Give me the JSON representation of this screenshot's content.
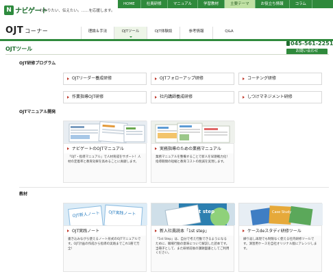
{
  "brand": {
    "logo_mark": "N",
    "logo_text": "ナビゲート",
    "tagline": "わかりたい、伝えたい。……を応援します。"
  },
  "topnav": [
    {
      "label": "HOME",
      "active": false
    },
    {
      "label": "社員研修",
      "active": false
    },
    {
      "label": "マニュアル",
      "active": false
    },
    {
      "label": "学習教材",
      "active": false
    },
    {
      "label": "主要テーマ",
      "active": true
    },
    {
      "label": "お役立ち情報",
      "active": false
    },
    {
      "label": "コラム",
      "active": false
    }
  ],
  "header": {
    "title": "OJT",
    "title_sub": "コーナー",
    "phone": "045-561-2251",
    "contact_label": "お問い合わせ"
  },
  "mainnav": [
    {
      "label": "理論＆手法",
      "active": false
    },
    {
      "label": "OJTツール",
      "active": true
    },
    {
      "label": "OJT体験談",
      "active": false
    },
    {
      "label": "参考情報",
      "active": false
    },
    {
      "label": "Q&A",
      "active": false
    }
  ],
  "section_title": "OJTツール",
  "programs": {
    "heading": "OJT研修プログラム",
    "items": [
      "OJTリーダー養成研修",
      "OJTフォローアップ研修",
      "コーチング研修",
      "作業指導OJT研修",
      "社内講師養成研修",
      "しつけマネジメント研修"
    ]
  },
  "manual": {
    "heading": "OJTマニュアル開発",
    "cards": [
      {
        "label": "ナビゲートのOJTマニュアル",
        "desc": "「OJT・指導マニュアル」で人材育成をサポート！人材の定着率と教育効果を高めることに貢献します。"
      },
      {
        "label": "実務指導のための業務マニュアル",
        "desc": "業務マニュアルを整備することで新人を早期戦力化！指導期間の短縮と教育コストの削減を実現します。"
      }
    ]
  },
  "materials": {
    "heading": "教材",
    "cards": [
      {
        "label": "OJT実践ノート",
        "thumb_text_1": "OJT新人ノート",
        "thumb_text_2": "OJT実践ノート",
        "desc": "書き込みながら使えるノート形式のOJTマニュアルです。OJT計画の作成から指導の実践までこれ1冊で万全！"
      },
      {
        "label": "新入社員読本「1st step」",
        "thumb_text_1": "1st step",
        "desc": "「1st Step」は、自分で考え行動できるようになるために、職場行動の意味について解説した読本です。当冊子として、また研修前後の課題図書としてご利用ください。"
      },
      {
        "label": "ケースdeスタディ研修ツール",
        "thumb_text_1": "Case Study",
        "desc": "繰り返し再現でも制限なく使える社内研修ツールです。演習用ケースを自社オリジナル版にアレンジします。"
      }
    ]
  },
  "colors": {
    "brand_green": "#2f8a3c",
    "accent_red": "#c0392b"
  }
}
